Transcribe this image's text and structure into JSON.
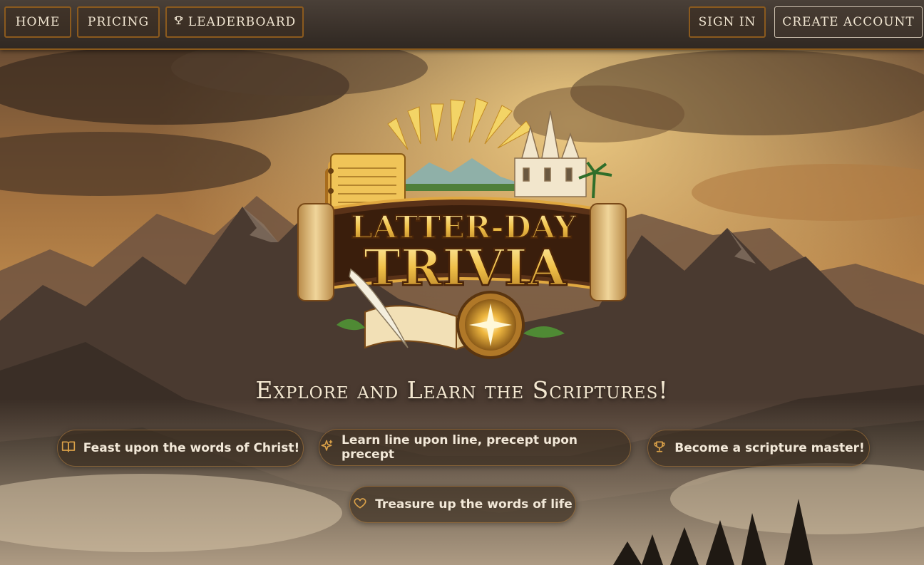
{
  "nav": {
    "home": "HOME",
    "pricing": "PRICING",
    "leaderboard": "LEADERBOARD",
    "sign_in": "SIGN IN",
    "create_account": "CREATE ACCOUNT"
  },
  "logo": {
    "line1": "LATTER-DAY",
    "line2": "TRIVIA"
  },
  "hero": {
    "tagline": "Explore and Learn the Scriptures!"
  },
  "features": [
    {
      "icon": "book-open-icon",
      "text": "Feast upon the words of Christ!"
    },
    {
      "icon": "sparkle-icon",
      "text": "Learn line upon line, precept upon precept"
    },
    {
      "icon": "trophy-icon",
      "text": "Become a scripture master!"
    },
    {
      "icon": "heart-icon",
      "text": "Treasure up the words of life"
    }
  ],
  "colors": {
    "accent": "#c9872f",
    "nav_border": "#8b5a1e",
    "text_light": "#f2e8d8"
  }
}
